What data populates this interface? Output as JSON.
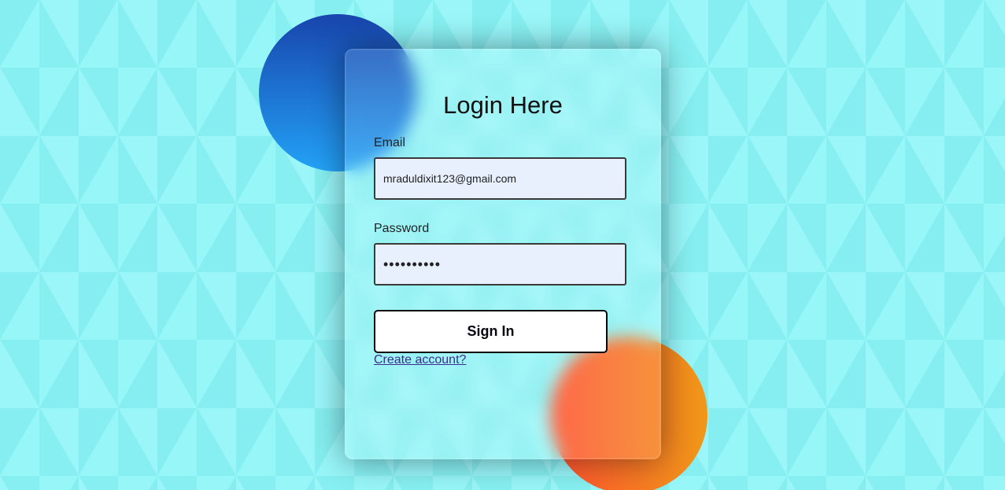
{
  "login": {
    "title": "Login Here",
    "email_label": "Email",
    "email_value": "mraduldixit123@gmail.com",
    "password_label": "Password",
    "password_value": "••••••••••",
    "signin_label": "Sign In",
    "create_account_label": "Create account?"
  },
  "colors": {
    "background": "#8ef5f7",
    "blue_shape_gradient": [
      "#1845ad",
      "#23a2f6"
    ],
    "orange_shape_gradient": [
      "#ff512f",
      "#f09819"
    ],
    "input_background": "#e8f0fe",
    "link": "#3e2d8f"
  }
}
